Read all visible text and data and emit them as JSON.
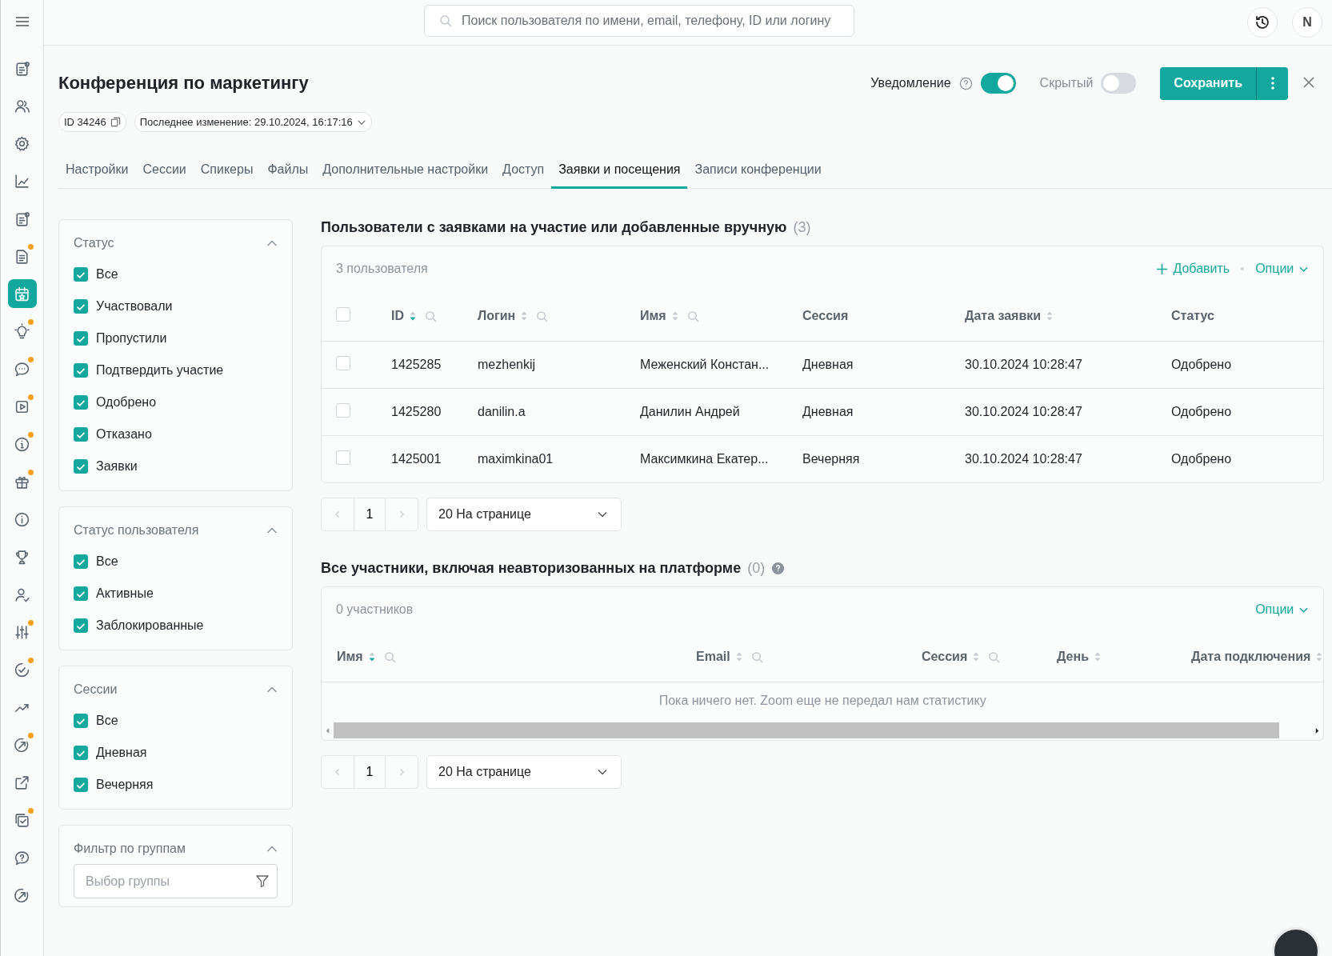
{
  "sidebar": {
    "items": [
      {
        "selected": false,
        "badge": false
      },
      {
        "selected": false,
        "badge": false
      },
      {
        "selected": false,
        "badge": false
      },
      {
        "selected": false,
        "badge": false
      },
      {
        "selected": false,
        "badge": false
      },
      {
        "selected": false,
        "badge": true
      },
      {
        "selected": true,
        "badge": false
      },
      {
        "selected": false,
        "badge": true
      },
      {
        "selected": false,
        "badge": true
      },
      {
        "selected": false,
        "badge": true
      },
      {
        "selected": false,
        "badge": true
      },
      {
        "selected": false,
        "badge": true
      },
      {
        "selected": false,
        "badge": false
      },
      {
        "selected": false,
        "badge": false
      },
      {
        "selected": false,
        "badge": false
      },
      {
        "selected": false,
        "badge": true
      },
      {
        "selected": false,
        "badge": true
      },
      {
        "selected": false,
        "badge": false
      },
      {
        "selected": false,
        "badge": true
      },
      {
        "selected": false,
        "badge": false
      },
      {
        "selected": false,
        "badge": true
      },
      {
        "selected": false,
        "badge": false
      },
      {
        "selected": false,
        "badge": false
      }
    ]
  },
  "search": {
    "placeholder": "Поиск пользователя по имени, email, телефону, ID или логину"
  },
  "avatar": "N",
  "page": {
    "title": "Конференция по маркетингу",
    "id_chip": "ID 34246",
    "last_modified": "Последнее изменение: 29.10.2024, 16:17:16"
  },
  "toggles": [
    {
      "label": "Уведомление",
      "on": true,
      "help": true
    },
    {
      "label": "Скрытый",
      "on": false,
      "help": false
    }
  ],
  "save_button": "Сохранить",
  "tabs": [
    {
      "label": "Настройки",
      "selected": false
    },
    {
      "label": "Сессии",
      "selected": false
    },
    {
      "label": "Спикеры",
      "selected": false
    },
    {
      "label": "Файлы",
      "selected": false
    },
    {
      "label": "Дополнительные настройки",
      "selected": false
    },
    {
      "label": "Доступ",
      "selected": false
    },
    {
      "label": "Заявки и посещения",
      "selected": true
    },
    {
      "label": "Записи конференции",
      "selected": false
    }
  ],
  "filters": [
    {
      "title": "Статус",
      "expanded": true,
      "options": [
        {
          "label": "Все",
          "checked": true
        },
        {
          "label": "Участвовали",
          "checked": true
        },
        {
          "label": "Пропустили",
          "checked": true
        },
        {
          "label": "Подтвердить участие",
          "checked": true
        },
        {
          "label": "Одобрено",
          "checked": true
        },
        {
          "label": "Отказано",
          "checked": true
        },
        {
          "label": "Заявки",
          "checked": true
        }
      ]
    },
    {
      "title": "Статус пользователя",
      "expanded": true,
      "options": [
        {
          "label": "Все",
          "checked": true
        },
        {
          "label": "Активные",
          "checked": true
        },
        {
          "label": "Заблокированные",
          "checked": true
        }
      ]
    },
    {
      "title": "Сессии",
      "expanded": true,
      "options": [
        {
          "label": "Все",
          "checked": true
        },
        {
          "label": "Дневная",
          "checked": true
        },
        {
          "label": "Вечерняя",
          "checked": true
        }
      ]
    },
    {
      "title": "Фильтр по группам",
      "expanded": true,
      "select": {
        "placeholder": "Выбор группы"
      }
    }
  ],
  "applications": {
    "title": "Пользователи с заявками на участие или добавленные вручную",
    "count": "(3)",
    "summary": "3 пользователя",
    "add_button": "Добавить",
    "options_button": "Опции",
    "all_checked": false,
    "columns": [
      {
        "label": "ID",
        "sortable": true,
        "sorted": true,
        "searchable": true
      },
      {
        "label": "Логин",
        "sortable": true,
        "sorted": false,
        "searchable": true
      },
      {
        "label": "Имя",
        "sortable": true,
        "sorted": false,
        "searchable": true
      },
      {
        "label": "Сессия",
        "sortable": false,
        "searchable": false
      },
      {
        "label": "Дата заявки",
        "sortable": true,
        "sorted": false,
        "searchable": false
      },
      {
        "label": "Статус",
        "sortable": false,
        "searchable": false
      }
    ],
    "rows": [
      {
        "checked": false,
        "cells": [
          "1425285",
          "mezhenkij",
          "Меженский Констан...",
          "Дневная",
          "30.10.2024 10:28:47",
          "Одобрено"
        ]
      },
      {
        "checked": false,
        "cells": [
          "1425280",
          "danilin.a",
          "Данилин Андрей",
          "Дневная",
          "30.10.2024 10:28:47",
          "Одобрено"
        ]
      },
      {
        "checked": false,
        "cells": [
          "1425001",
          "maximkina01",
          "Максимкина Екатер...",
          "Вечерняя",
          "30.10.2024 10:28:47",
          "Одобрено"
        ]
      }
    ],
    "pagination": {
      "page": "1",
      "page_size": "20 На странице"
    }
  },
  "participants": {
    "title": "Все участники, включая неавторизованных на платформе",
    "count": "(0)",
    "summary": "0 участников",
    "options_button": "Опции",
    "columns": [
      {
        "label": "Имя",
        "sortable": true,
        "sorted": true,
        "searchable": true
      },
      {
        "label": "Email",
        "sortable": true,
        "sorted": false,
        "searchable": true
      },
      {
        "label": "Сессия",
        "sortable": true,
        "sorted": false,
        "searchable": true
      },
      {
        "label": "День",
        "sortable": true,
        "sorted": false,
        "searchable": false
      },
      {
        "label": "Дата подключения",
        "sortable": true,
        "sorted": false,
        "searchable": false
      }
    ],
    "empty_message": "Пока ничего нет. Zoom еще не передал нам статистику",
    "pagination": {
      "page": "1",
      "page_size": "20 На странице"
    }
  }
}
